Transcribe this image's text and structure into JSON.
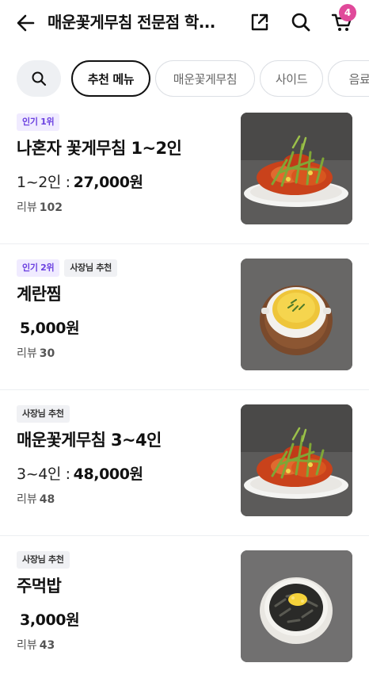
{
  "header": {
    "title": "매운꽃게무침 전문점 학...",
    "cart_count": "4"
  },
  "tabs": [
    {
      "label": "추천 메뉴",
      "active": true
    },
    {
      "label": "매운꽃게무침"
    },
    {
      "label": "사이드"
    },
    {
      "label": "음료"
    }
  ],
  "menu": [
    {
      "badges": [
        {
          "text": "인기 1위",
          "kind": "popular"
        }
      ],
      "name": "나혼자 꽃게무침 1~2인",
      "option": "1~2인 :",
      "price": "27,000원",
      "review_label": "리뷰",
      "review_count": "102",
      "image": "spicy-crab-dish"
    },
    {
      "badges": [
        {
          "text": "인기 2위",
          "kind": "popular"
        },
        {
          "text": "사장님 추천",
          "kind": "owner"
        }
      ],
      "name": "계란찜",
      "option": "",
      "price": "5,000원",
      "review_label": "리뷰",
      "review_count": "30",
      "image": "steamed-egg-dish"
    },
    {
      "badges": [
        {
          "text": "사장님 추천",
          "kind": "owner"
        }
      ],
      "name": "매운꽃게무침 3~4인",
      "option": "3~4인 :",
      "price": "48,000원",
      "review_label": "리뷰",
      "review_count": "48",
      "image": "spicy-crab-dish"
    },
    {
      "badges": [
        {
          "text": "사장님 추천",
          "kind": "owner"
        }
      ],
      "name": "주먹밥",
      "option": "",
      "price": "3,000원",
      "review_label": "리뷰",
      "review_count": "43",
      "image": "rice-ball-dish"
    }
  ],
  "colors": {
    "badge_popular_text": "#6a3fe0",
    "badge_popular_bg": "#f0ebff",
    "cart_badge": "#e0499a"
  }
}
